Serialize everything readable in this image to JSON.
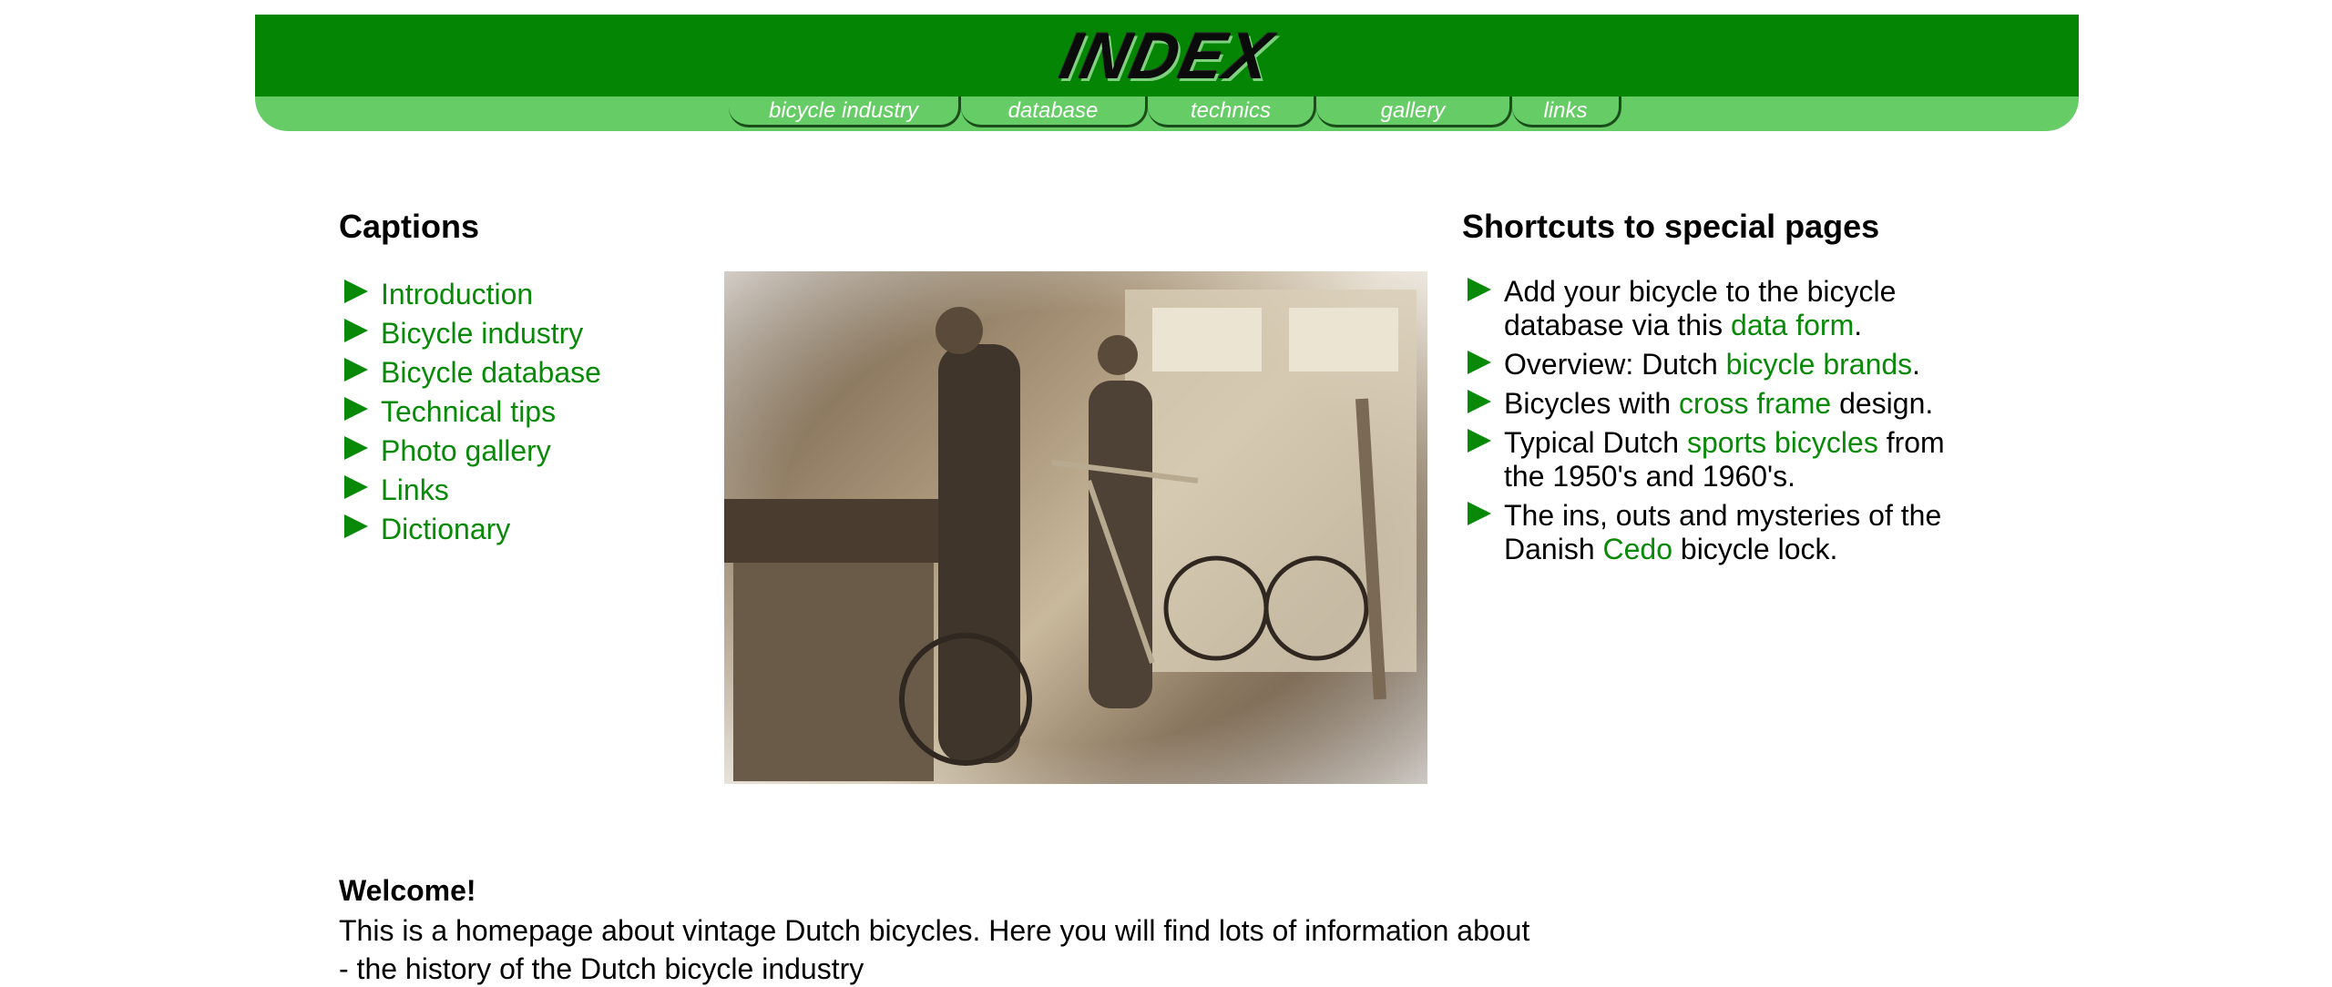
{
  "header": {
    "logo_text": "INDEX",
    "tabs": [
      {
        "label": "bicycle industry"
      },
      {
        "label": "database"
      },
      {
        "label": "technics"
      },
      {
        "label": "gallery"
      },
      {
        "label": "links"
      }
    ],
    "colors": {
      "banner_dark": "#048604",
      "banner_light": "#66cc66",
      "link": "#088a08"
    }
  },
  "captions": {
    "title": "Captions",
    "items": [
      {
        "label": "Introduction"
      },
      {
        "label": "Bicycle industry"
      },
      {
        "label": "Bicycle database"
      },
      {
        "label": "Technical tips"
      },
      {
        "label": "Photo gallery"
      },
      {
        "label": "Links"
      },
      {
        "label": "Dictionary"
      }
    ]
  },
  "shortcuts": {
    "title": "Shortcuts to special pages",
    "items": [
      {
        "before": "Add your bicycle to the bicycle database via this ",
        "link": "data form",
        "after": "."
      },
      {
        "before": "Overview: Dutch ",
        "link": "bicycle brands",
        "after": "."
      },
      {
        "before": "Bicycles with ",
        "link": "cross frame",
        "after": " design."
      },
      {
        "before": "Typical Dutch ",
        "link": "sports bicycles",
        "after": " from the 1950's and 1960's."
      },
      {
        "before": "The ins, outs and mysteries of the Danish ",
        "link": "Cedo",
        "after": " bicycle lock."
      }
    ]
  },
  "welcome": {
    "title": "Welcome!",
    "text": "This is a homepage about vintage Dutch bicycles. Here you will find lots of information about",
    "text2": "- the history of the Dutch bicycle industry"
  },
  "icons": {
    "bullet": "green-triangle-arrow-icon"
  }
}
